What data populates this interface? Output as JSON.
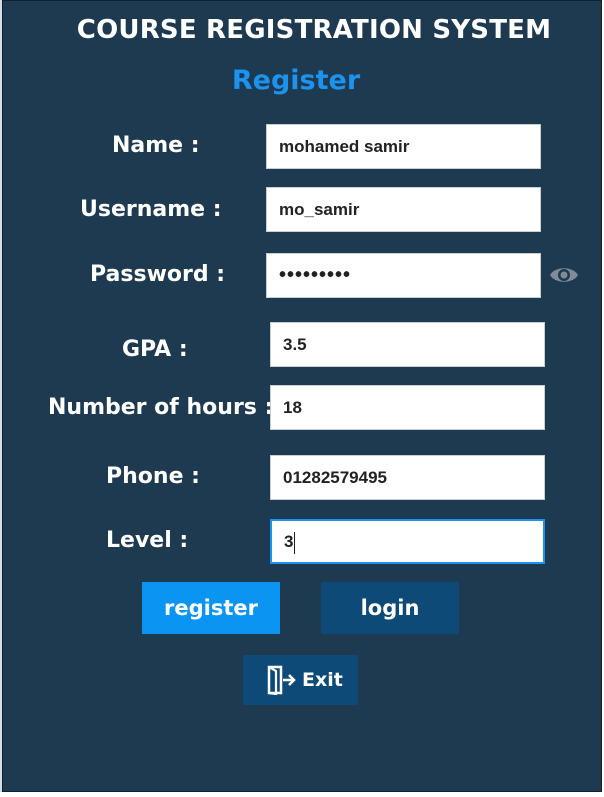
{
  "app": {
    "title": "COURSE REGISTRATION SYSTEM",
    "subtitle": "Register"
  },
  "form": {
    "name": {
      "label": "Name :",
      "value": "mohamed samir"
    },
    "username": {
      "label": "Username :",
      "value": "mo_samir"
    },
    "password": {
      "label": "Password :",
      "value": "•••••••••",
      "icon": "eye-icon"
    },
    "gpa": {
      "label": "GPA :",
      "value": "3.5"
    },
    "hours": {
      "label": "Number of hours :",
      "value": "18"
    },
    "phone": {
      "label": "Phone :",
      "value": "01282579495"
    },
    "level": {
      "label": "Level :",
      "value": "3"
    }
  },
  "buttons": {
    "register": "register",
    "login": "login",
    "exit": "Exit",
    "exit_icon": "exit-door-icon"
  },
  "colors": {
    "background": "#1e3a50",
    "accent": "#1b93ef",
    "register_button": "#0b95f3",
    "secondary_button": "#0d4a78"
  }
}
